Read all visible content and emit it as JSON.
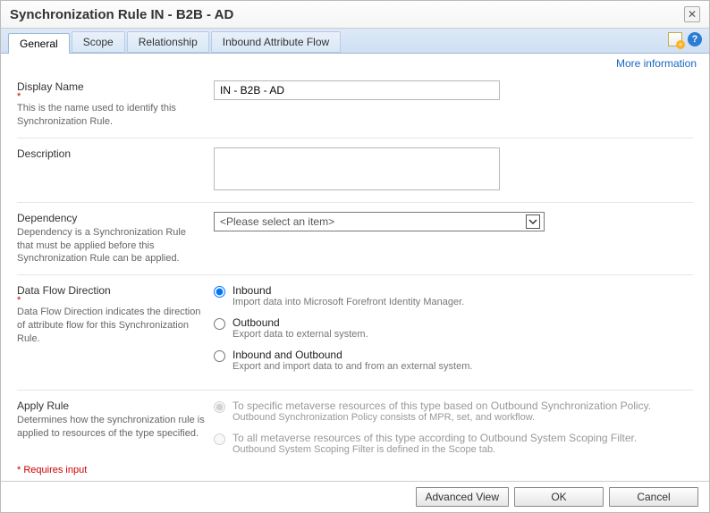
{
  "window": {
    "title": "Synchronization Rule IN - B2B - AD"
  },
  "tabs": {
    "items": [
      {
        "label": "General",
        "active": true
      },
      {
        "label": "Scope",
        "active": false
      },
      {
        "label": "Relationship",
        "active": false
      },
      {
        "label": "Inbound Attribute Flow",
        "active": false
      }
    ]
  },
  "moreInfo": "More information",
  "fields": {
    "displayName": {
      "label": "Display Name",
      "hint": "This is the name used to identify this Synchronization Rule.",
      "value": "IN - B2B - AD",
      "required": true
    },
    "description": {
      "label": "Description",
      "value": ""
    },
    "dependency": {
      "label": "Dependency",
      "hint": "Dependency is a Synchronization Rule that must be applied before this Synchronization Rule can be applied.",
      "placeholder": "<Please select an item>"
    },
    "dataFlow": {
      "label": "Data Flow Direction",
      "hint": "Data Flow Direction indicates the direction of attribute flow for this Synchronization Rule.",
      "required": true,
      "options": [
        {
          "label": "Inbound",
          "hint": "Import data into Microsoft Forefront Identity Manager.",
          "checked": true
        },
        {
          "label": "Outbound",
          "hint": "Export data to external system.",
          "checked": false
        },
        {
          "label": "Inbound and Outbound",
          "hint": "Export and import data to and from an external system.",
          "checked": false
        }
      ]
    },
    "applyRule": {
      "label": "Apply Rule",
      "hint": "Determines how the synchronization rule is applied to resources of the type specified.",
      "options": [
        {
          "label": "To specific metaverse resources of this type based on Outbound Synchronization Policy.",
          "hint": "Outbound Synchronization Policy consists of MPR, set, and workflow.",
          "checked": true
        },
        {
          "label": "To all metaverse resources of this type according to Outbound System Scoping Filter.",
          "hint": "Outbound System Scoping Filter is defined in the Scope tab.",
          "checked": false
        }
      ]
    }
  },
  "requiresNote": "* Requires input",
  "footer": {
    "advanced": "Advanced View",
    "ok": "OK",
    "cancel": "Cancel"
  }
}
